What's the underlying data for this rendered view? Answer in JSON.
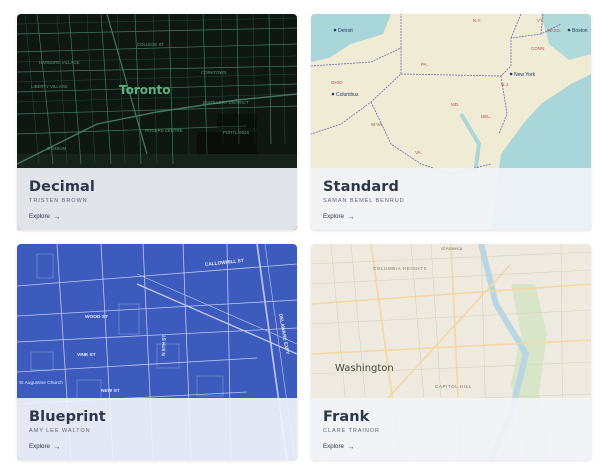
{
  "cards": [
    {
      "title": "Decimal",
      "author": "TRISTEN BROWN",
      "explore_label": "Explore",
      "map_labels": {
        "city": "Toronto",
        "streets": [
          "CAMDEN ST",
          "QUEEN ST W",
          "COLLEGE ST",
          "KING ST",
          "PORTLANDS",
          "LIBERTY VILLAGE",
          "HARBORD VILLAGE",
          "DISTILLERY DISTRICT",
          "CORKTOWN",
          "CHURCH-WELLESLEY VILLAGE",
          "STADIUM",
          "ROGERS CENTRE"
        ]
      },
      "colors": {
        "bg": "#0e1712",
        "line": "#4f8a70",
        "label": "#5fae86"
      }
    },
    {
      "title": "Standard",
      "author": "SAMAN BEMEL BENRUD",
      "explore_label": "Explore",
      "map_labels": {
        "cities": [
          "Detroit",
          "Columbus",
          "New York",
          "Boston"
        ],
        "states": [
          "N.Y.",
          "PA.",
          "OHIO",
          "W.VA.",
          "VA.",
          "MD.",
          "N.J.",
          "CONN.",
          "MASS.",
          "VT.",
          "DEL."
        ]
      },
      "colors": {
        "land": "#f0ebd5",
        "water": "#a9d7d9",
        "border": "#6a6ab3",
        "state_label": "#b64d4d"
      }
    },
    {
      "title": "Blueprint",
      "author": "AMY LEE WALTON",
      "explore_label": "Explore",
      "map_labels": {
        "streets": [
          "CALLOWHILL ST",
          "WOOD ST",
          "VINE ST",
          "NEW ST",
          "N 3RD ST",
          "N 4TH ST",
          "N 5TH ST",
          "N 2ND ST",
          "DELAWARE EXPY"
        ],
        "places": [
          "St Augustine Church"
        ]
      },
      "colors": {
        "bg": "#3c5bbd",
        "line": "#d5ddff"
      }
    },
    {
      "title": "Frank",
      "author": "CLARE TRAINOR",
      "explore_label": "Explore",
      "map_labels": {
        "city": "Washington",
        "places": [
          "COLUMBIA HEIGHTS",
          "CAPITOL HILL",
          "of America"
        ]
      },
      "colors": {
        "land": "#efeadf",
        "road": "#f3d8a3",
        "water": "#b8d6e4",
        "park": "#d8e5c8"
      }
    }
  ]
}
